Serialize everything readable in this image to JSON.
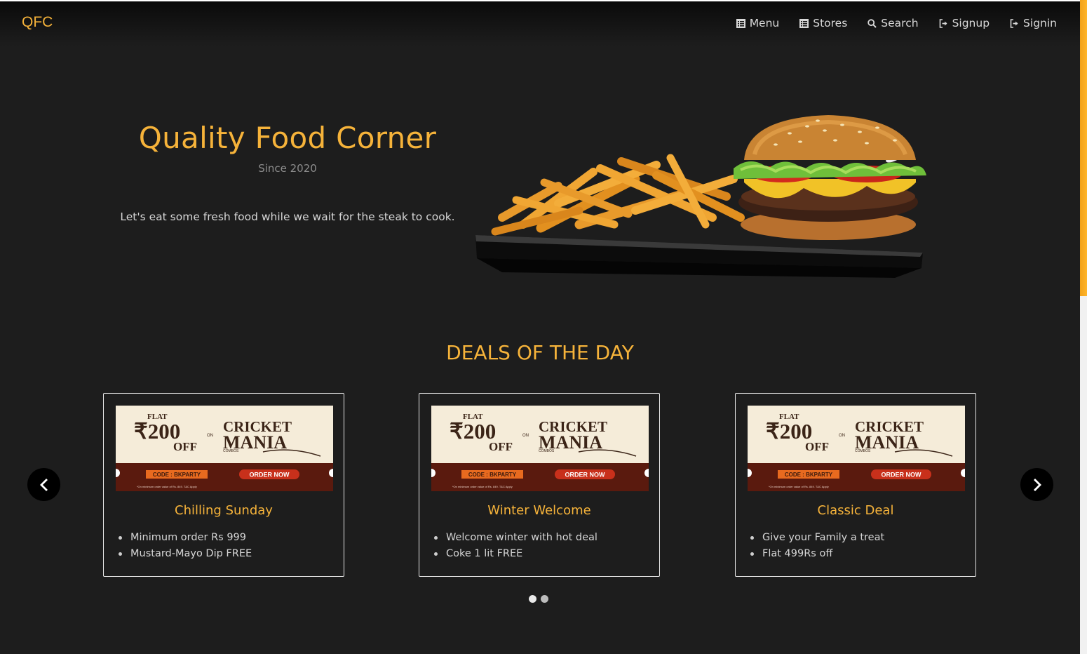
{
  "navbar": {
    "brand": "QFC",
    "links": [
      {
        "label": "Menu",
        "icon": "list-icon"
      },
      {
        "label": "Stores",
        "icon": "list-icon"
      },
      {
        "label": "Search",
        "icon": "search-icon"
      },
      {
        "label": "Signup",
        "icon": "sign-in-icon"
      },
      {
        "label": "Signin",
        "icon": "sign-in-icon"
      }
    ]
  },
  "hero": {
    "title": "Quality Food Corner",
    "since": "Since 2020",
    "tagline": "Let's eat some fresh food while we wait for the steak to cook."
  },
  "deals": {
    "title": "DEALS OF THE DAY",
    "banner": {
      "flat": "FLAT",
      "amount": "₹200",
      "off": "OFF",
      "on": "ON",
      "brand_line1": "CRICKET",
      "brand_line2": "MANIA",
      "combos": "COMBOS",
      "code": "CODE : BKPARTY",
      "order": "ORDER NOW",
      "fine_print": "*On minimum order value of Rs. 849. T&C Apply"
    },
    "cards": [
      {
        "title": "Chilling Sunday",
        "items": [
          "Minimum order Rs 999",
          "Mustard-Mayo Dip FREE"
        ]
      },
      {
        "title": "Winter Welcome",
        "items": [
          "Welcome winter with hot deal",
          "Coke 1 lit FREE"
        ]
      },
      {
        "title": "Classic Deal",
        "items": [
          "Give your Family a treat",
          "Flat 499Rs off"
        ]
      }
    ],
    "prev_icon": "chevron-left-icon",
    "next_icon": "chevron-right-icon",
    "dots": 2,
    "active_dot": 0
  },
  "colors": {
    "accent": "#f6b33a",
    "background": "#1d1d1d",
    "banner_cream": "#f5ecd9",
    "banner_brown": "#5a1a0e",
    "banner_orange": "#e86a1f"
  }
}
